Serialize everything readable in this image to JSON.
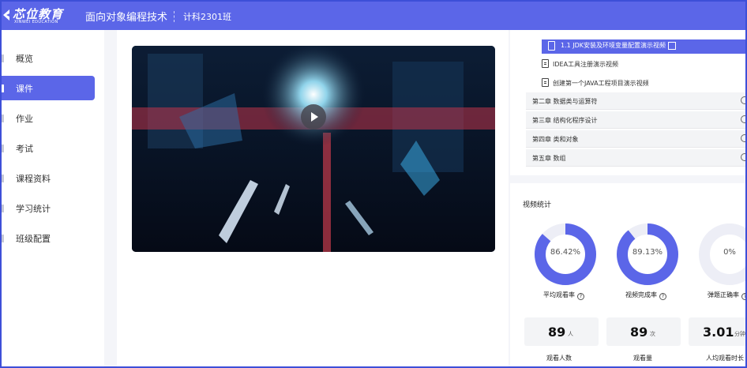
{
  "header": {
    "logo_text": "芯位教育",
    "logo_subtext": "XINWEI EDUCATION",
    "course_title": "面向对象编程技术",
    "class_name": "计科2301班"
  },
  "sidebar": {
    "items": [
      {
        "label": "概览",
        "active": false
      },
      {
        "label": "课件",
        "active": true
      },
      {
        "label": "作业",
        "active": false
      },
      {
        "label": "考试",
        "active": false
      },
      {
        "label": "课程资料",
        "active": false
      },
      {
        "label": "学习统计",
        "active": false
      },
      {
        "label": "班级配置",
        "active": false
      }
    ]
  },
  "video": {
    "play_icon": "play-icon"
  },
  "lessons": {
    "current": "1.1 JDK安装及环境变量配置演示视频",
    "items": [
      "IDEA工具注册演示视频",
      "创建第一个JAVA工程项目演示视频"
    ]
  },
  "chapters": [
    "第二章 数据类与运算符",
    "第三章 结构化程序设计",
    "第四章 类和对象",
    "第五章 数组"
  ],
  "stats": {
    "title": "视频统计",
    "donuts": [
      {
        "value": 0.8642,
        "text": "86.42%",
        "label": "平均观看率"
      },
      {
        "value": 0.8913,
        "text": "89.13%",
        "label": "视频完成率"
      },
      {
        "value": 0,
        "text": "0%",
        "label": "弹题正确率"
      }
    ],
    "boxes": [
      {
        "number": "89",
        "unit": "人",
        "label": "观看人数"
      },
      {
        "number": "89",
        "unit": "次",
        "label": "观看量"
      },
      {
        "number": "3.01",
        "unit": "分钟",
        "label": "人均观看时长"
      }
    ]
  },
  "colors": {
    "accent": "#5b66e8",
    "donut_track": "#edeef6"
  }
}
